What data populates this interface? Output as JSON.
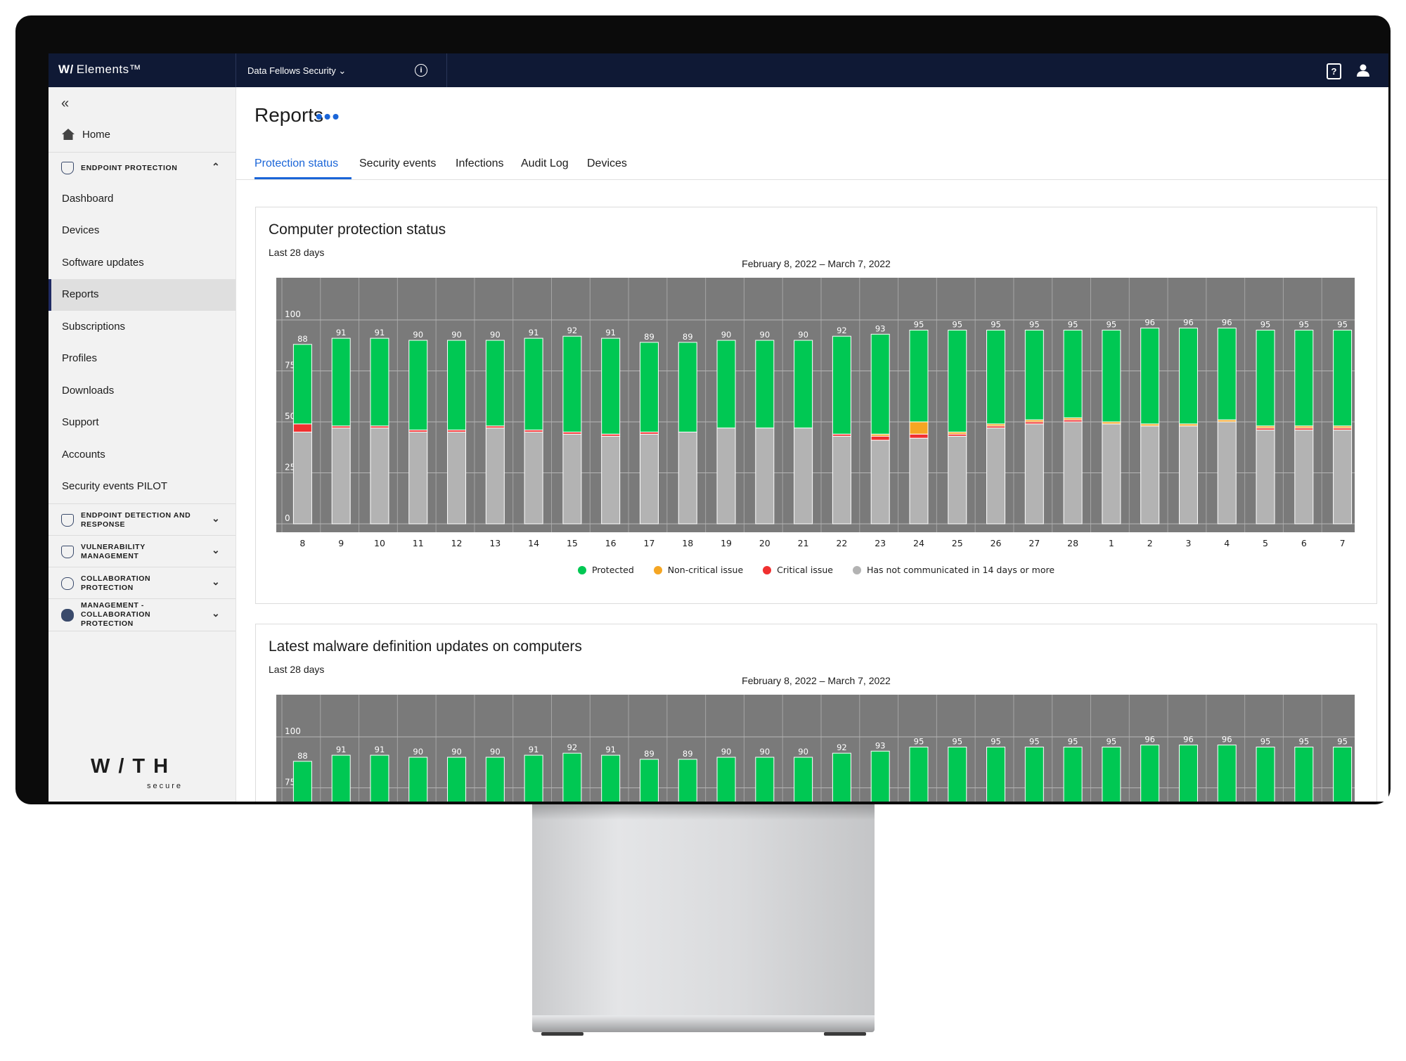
{
  "topbar": {
    "brand_mark": "W/",
    "brand_name": "Elements™",
    "organization": "Data Fellows Security",
    "info_icon": "info-icon",
    "help_icon": "help-icon",
    "user_icon": "user-icon"
  },
  "sidebar": {
    "collapse_icon": "double-chevron-left-icon",
    "home_label": "Home",
    "section_endpoint": "ENDPOINT PROTECTION",
    "items": [
      "Dashboard",
      "Devices",
      "Software updates",
      "Reports",
      "Subscriptions",
      "Profiles",
      "Downloads",
      "Support",
      "Accounts",
      "Security events PILOT"
    ],
    "active_item": "Reports",
    "sections": [
      {
        "line1": "ENDPOINT DETECTION AND",
        "line2": "RESPONSE",
        "line3": ""
      },
      {
        "line1": "VULNERABILITY",
        "line2": "MANAGEMENT",
        "line3": ""
      },
      {
        "line1": "COLLABORATION",
        "line2": "PROTECTION",
        "line3": ""
      },
      {
        "line1": "MANAGEMENT -",
        "line2": "COLLABORATION",
        "line3": "PROTECTION"
      }
    ],
    "footer_logo": "W/TH",
    "footer_logo_sub": "secure"
  },
  "main": {
    "title": "Reports",
    "more_icon": "more-horizontal-icon",
    "tabs": [
      "Protection status",
      "Security events",
      "Infections",
      "Audit Log",
      "Devices"
    ],
    "active_tab": "Protection status"
  },
  "colors": {
    "protected": "#00c853",
    "non_critical": "#f5a623",
    "critical": "#f03030",
    "not_communicated": "#b3b3b3",
    "plot_bg": "#7a7a7a",
    "accent": "#1a65d8",
    "topbar": "#0f1935"
  },
  "cards": [
    {
      "title": "Computer protection status",
      "subtitle": "Last 28 days",
      "range": "February 8, 2022 – March 7, 2022"
    },
    {
      "title": "Latest malware definition updates on computers",
      "subtitle": "Last 28 days",
      "range": "February 8, 2022 – March 7, 2022"
    }
  ],
  "chart_data": [
    {
      "type": "bar",
      "stacked": true,
      "title": "Computer protection status",
      "categories": [
        "8",
        "9",
        "10",
        "11",
        "12",
        "13",
        "14",
        "15",
        "16",
        "17",
        "18",
        "19",
        "20",
        "21",
        "22",
        "23",
        "24",
        "25",
        "26",
        "27",
        "28",
        "1",
        "2",
        "3",
        "4",
        "5",
        "6",
        "7"
      ],
      "totals": [
        88,
        91,
        91,
        90,
        90,
        90,
        91,
        92,
        91,
        89,
        89,
        90,
        90,
        90,
        92,
        93,
        95,
        95,
        95,
        95,
        95,
        95,
        96,
        96,
        96,
        95,
        95,
        95
      ],
      "series": [
        {
          "name": "Has not communicated in 14 days or more",
          "color": "#b3b3b3",
          "values": [
            45,
            47,
            47,
            45,
            45,
            47,
            45,
            44,
            43,
            44,
            45,
            47,
            47,
            47,
            43,
            41,
            42,
            43,
            47,
            49,
            50,
            49,
            48,
            48,
            50,
            46,
            46,
            46
          ]
        },
        {
          "name": "Critical issue",
          "color": "#f03030",
          "values": [
            4,
            1,
            1,
            1,
            1,
            1,
            1,
            1,
            1,
            1,
            0,
            0,
            0,
            0,
            1,
            2,
            2,
            1,
            1,
            1,
            1,
            0,
            0,
            0,
            0,
            1,
            1,
            1
          ]
        },
        {
          "name": "Non-critical issue",
          "color": "#f5a623",
          "values": [
            0,
            0,
            0,
            0,
            0,
            0,
            0,
            0,
            0,
            0,
            0,
            0,
            0,
            0,
            0,
            1,
            6,
            1,
            1,
            1,
            1,
            1,
            1,
            1,
            1,
            1,
            1,
            1
          ]
        },
        {
          "name": "Protected",
          "color": "#00c853",
          "values": [
            39,
            43,
            43,
            44,
            44,
            42,
            45,
            47,
            47,
            44,
            44,
            43,
            43,
            43,
            48,
            49,
            45,
            50,
            46,
            44,
            43,
            45,
            47,
            47,
            45,
            47,
            47,
            47
          ]
        }
      ],
      "ylim": [
        0,
        100
      ],
      "yticks": [
        0,
        25,
        50,
        75,
        100
      ],
      "legend": [
        "Protected",
        "Non-critical issue",
        "Critical issue",
        "Has not communicated in 14 days or more"
      ]
    },
    {
      "type": "bar",
      "title": "Latest malware definition updates on computers",
      "categories": [
        "8",
        "9",
        "10",
        "11",
        "12",
        "13",
        "14",
        "15",
        "16",
        "17",
        "18",
        "19",
        "20",
        "21",
        "22",
        "23",
        "24",
        "25",
        "26",
        "27",
        "28",
        "1",
        "2",
        "3",
        "4",
        "5",
        "6",
        "7"
      ],
      "totals": [
        88,
        91,
        91,
        90,
        90,
        90,
        91,
        92,
        91,
        89,
        89,
        90,
        90,
        90,
        92,
        93,
        95,
        95,
        95,
        95,
        95,
        95,
        96,
        96,
        96,
        95,
        95,
        95
      ],
      "ylim": [
        0,
        100
      ],
      "yticks_visible": [
        75,
        100
      ]
    }
  ]
}
